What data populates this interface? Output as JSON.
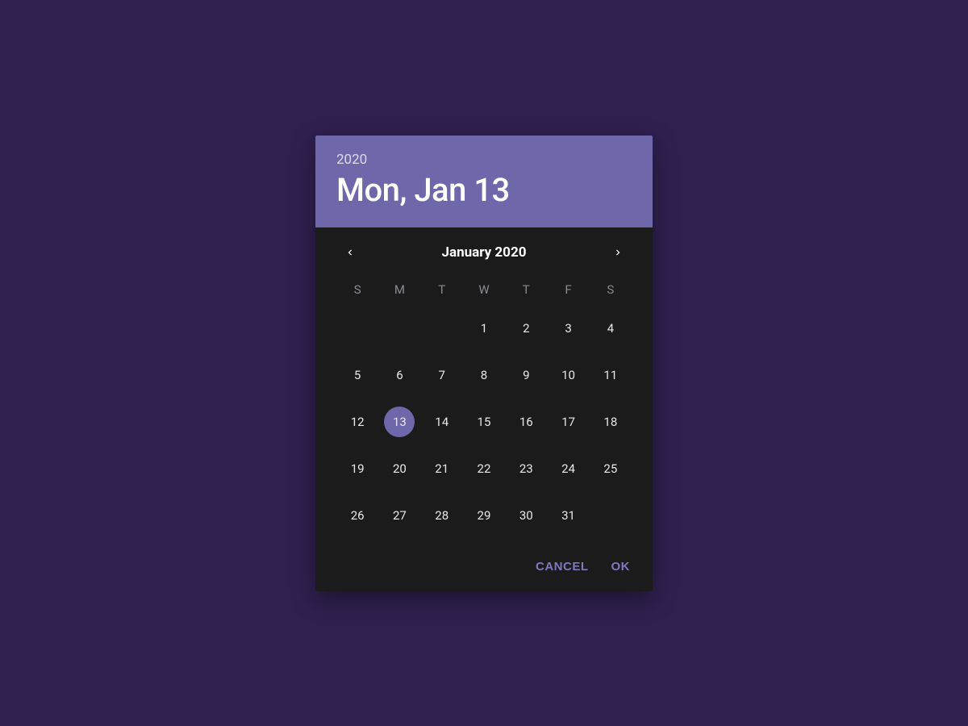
{
  "colors": {
    "accent": "#6e68aa",
    "surface": "#1b1b1b",
    "backdrop": "#2f2050"
  },
  "header": {
    "year": "2020",
    "date_display": "Mon, Jan 13"
  },
  "calendar": {
    "month_title": "January 2020",
    "weekdays": [
      "S",
      "M",
      "T",
      "W",
      "T",
      "F",
      "S"
    ],
    "first_weekday_index": 3,
    "days_in_month": 31,
    "selected_day": 13
  },
  "actions": {
    "cancel_label": "Cancel",
    "ok_label": "OK"
  }
}
